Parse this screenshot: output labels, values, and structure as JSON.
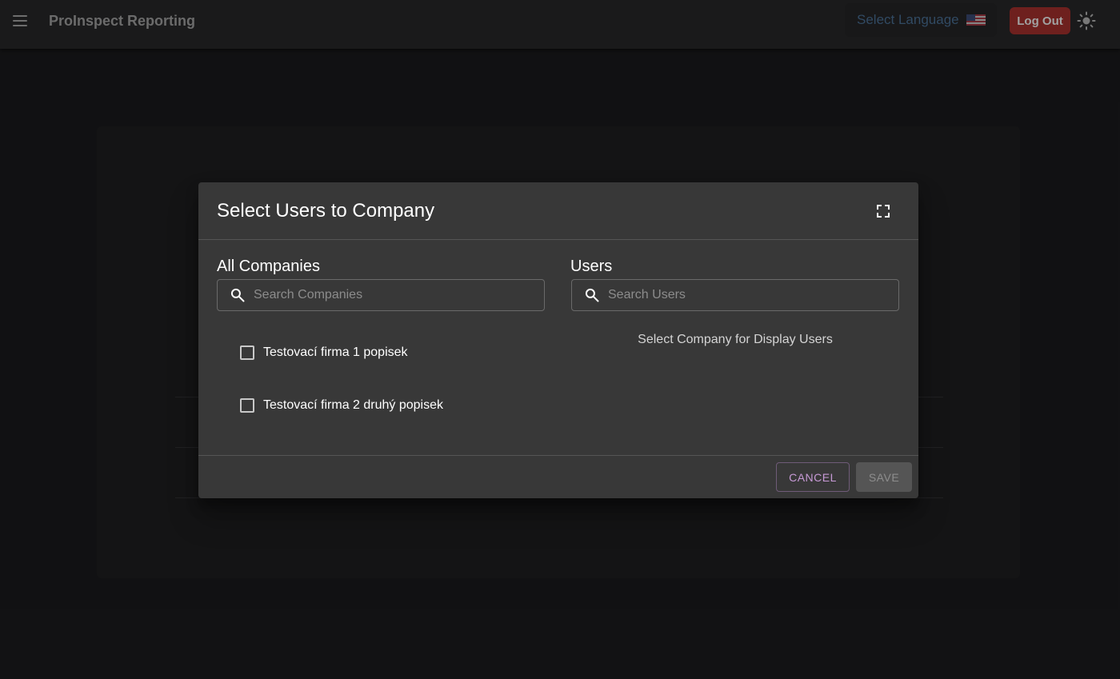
{
  "appbar": {
    "title": "ProInspect Reporting",
    "menu_icon": "hamburger-menu-icon",
    "language_label": "Select Language",
    "language_flag": "us-flag-icon",
    "logout_label": "Log Out",
    "theme_icon": "sun-icon"
  },
  "dialog": {
    "title": "Select Users to Company",
    "fullscreen_icon": "fullscreen-icon",
    "companies": {
      "heading": "All Companies",
      "search_placeholder": "Search Companies",
      "items": [
        {
          "label": "Testovací firma 1 popisek",
          "checked": false
        },
        {
          "label": "Testovací firma 2 druhý popisek",
          "checked": false
        }
      ]
    },
    "users": {
      "heading": "Users",
      "search_placeholder": "Search Users",
      "empty_hint": "Select Company for Display Users"
    },
    "footer": {
      "cancel_label": "CANCEL",
      "save_label": "SAVE"
    }
  },
  "colors": {
    "accent": "#c79ad6",
    "danger": "#8e2a27",
    "dialog_bg": "#383838",
    "page_bg": "#171719"
  }
}
